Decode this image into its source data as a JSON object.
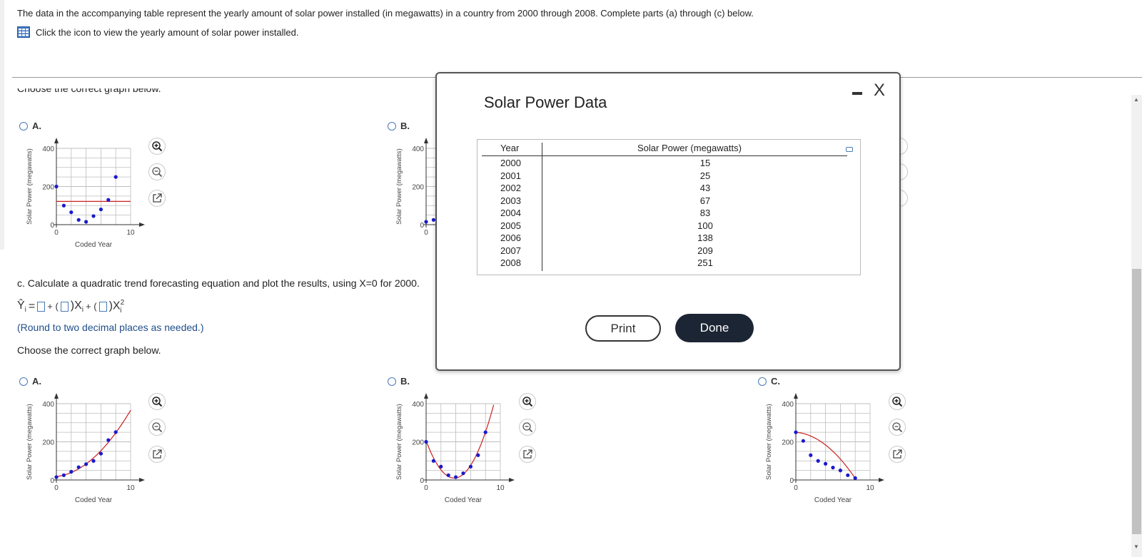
{
  "question": {
    "intro": "The data in the accompanying table represent the yearly amount of solar power installed (in megawatts) in a country from 2000 through 2008. Complete parts (a) through (c) below.",
    "table_link": "Click the icon to view the yearly amount of solar power installed.",
    "cut_text": "Choose the correct graph below."
  },
  "partb": {
    "optA": "A.",
    "optB": "B."
  },
  "partc": {
    "prompt": "c. Calculate a quadratic trend forecasting equation and plot the results, using X=0 for 2000.",
    "eq_yhat": "Ŷ",
    "eq_i": "i",
    "eq_eq": "=",
    "eq_plus1": "+ (",
    "eq_x1": ")X",
    "eq_plus2": "+ (",
    "eq_x2": ")X",
    "eq_sup": "2",
    "round_note": "(Round to two decimal places as needed.)",
    "choose": "Choose the correct graph below.",
    "optA": "A.",
    "optB": "B.",
    "optC": "C."
  },
  "graph_text": {
    "ylabel": "Solar Power (megawatts)",
    "xlabel": "Coded Year",
    "y400": "400",
    "y200": "200",
    "y0": "0",
    "x0": "0",
    "x10": "10"
  },
  "modal": {
    "title": "Solar Power Data",
    "col_year": "Year",
    "col_power": "Solar Power (megawatts)",
    "rows": [
      {
        "year": "2000",
        "power": "15"
      },
      {
        "year": "2001",
        "power": "25"
      },
      {
        "year": "2002",
        "power": "43"
      },
      {
        "year": "2003",
        "power": "67"
      },
      {
        "year": "2004",
        "power": "83"
      },
      {
        "year": "2005",
        "power": "100"
      },
      {
        "year": "2006",
        "power": "138"
      },
      {
        "year": "2007",
        "power": "209"
      },
      {
        "year": "2008",
        "power": "251"
      }
    ],
    "print_label": "Print",
    "done_label": "Done",
    "minimize_icon": "minimize-icon",
    "close_glyph": "X"
  },
  "colors": {
    "point": "#1a1acc",
    "trend": "#cc1f1f",
    "accent": "#4a7ab5",
    "done_bg": "#1c2533"
  },
  "chart_data": [
    {
      "id": "b-A",
      "type": "scatter",
      "xlabel": "Coded Year",
      "ylabel": "Solar Power (megawatts)",
      "xlim": [
        0,
        10
      ],
      "ylim": [
        0,
        400
      ],
      "points": [
        [
          0,
          200
        ],
        [
          1,
          100
        ],
        [
          2,
          65
        ],
        [
          3,
          25
        ],
        [
          4,
          15
        ],
        [
          5,
          45
        ],
        [
          6,
          80
        ],
        [
          7,
          130
        ],
        [
          8,
          250
        ]
      ],
      "line": {
        "kind": "horizontal",
        "y": 122
      }
    },
    {
      "id": "b-B",
      "type": "scatter",
      "xlabel": "Coded Year",
      "ylabel": "Solar Power (megawatts)",
      "xlim": [
        0,
        10
      ],
      "ylim": [
        0,
        400
      ],
      "points": [
        [
          0,
          15
        ],
        [
          1,
          25
        ]
      ]
    },
    {
      "id": "c-A",
      "type": "scatter",
      "xlabel": "Coded Year",
      "ylabel": "Solar Power (megawatts)",
      "xlim": [
        0,
        10
      ],
      "ylim": [
        0,
        400
      ],
      "points": [
        [
          0,
          15
        ],
        [
          1,
          25
        ],
        [
          2,
          43
        ],
        [
          3,
          67
        ],
        [
          4,
          83
        ],
        [
          5,
          100
        ],
        [
          6,
          138
        ],
        [
          7,
          209
        ],
        [
          8,
          251
        ]
      ],
      "curve": {
        "a": 18.5,
        "b": 4.2,
        "c": 3.05
      }
    },
    {
      "id": "c-B",
      "type": "scatter",
      "xlabel": "Coded Year",
      "ylabel": "Solar Power (megawatts)",
      "xlim": [
        0,
        10
      ],
      "ylim": [
        0,
        400
      ],
      "points": [
        [
          0,
          200
        ],
        [
          1,
          100
        ],
        [
          2,
          70
        ],
        [
          3,
          25
        ],
        [
          4,
          15
        ],
        [
          5,
          35
        ],
        [
          6,
          70
        ],
        [
          7,
          130
        ],
        [
          8,
          250
        ]
      ],
      "curve": {
        "a": 205,
        "b": -103,
        "c": 13.6
      }
    },
    {
      "id": "c-C",
      "type": "scatter",
      "xlabel": "Coded Year",
      "ylabel": "Solar Power (megawatts)",
      "xlim": [
        0,
        10
      ],
      "ylim": [
        0,
        400
      ],
      "points": [
        [
          0,
          250
        ],
        [
          1,
          205
        ],
        [
          2,
          130
        ],
        [
          3,
          100
        ],
        [
          4,
          85
        ],
        [
          5,
          65
        ],
        [
          6,
          50
        ],
        [
          7,
          25
        ],
        [
          8,
          10
        ]
      ],
      "curve": {
        "a": 250,
        "b": -3,
        "c": -3.4
      }
    }
  ]
}
